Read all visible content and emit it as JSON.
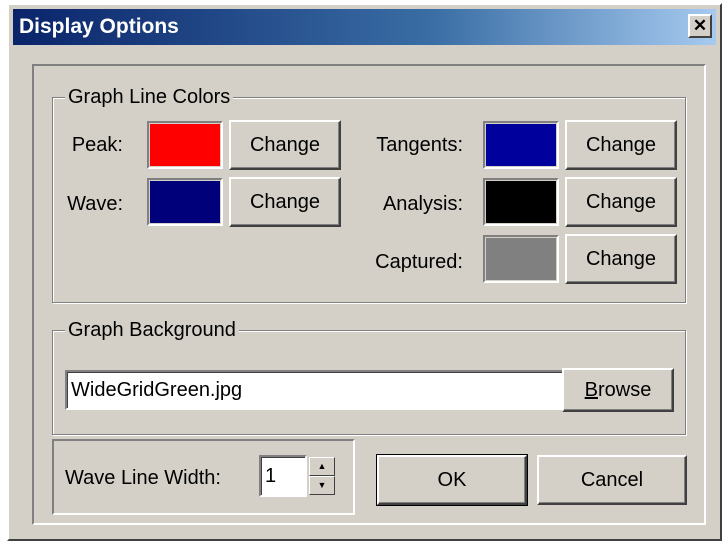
{
  "window": {
    "title": "Display Options",
    "close_glyph": "✕"
  },
  "graph_line_colors": {
    "legend": "Graph Line Colors",
    "items": [
      {
        "label": "Peak:",
        "color": "#ff0000",
        "button": "Change"
      },
      {
        "label": "Wave:",
        "color": "#00007b",
        "button": "Change"
      },
      {
        "label": "Tangents:",
        "color": "#00009c",
        "button": "Change"
      },
      {
        "label": "Analysis:",
        "color": "#000000",
        "button": "Change"
      },
      {
        "label": "Captured:",
        "color": "#808080",
        "button": "Change"
      }
    ]
  },
  "graph_background": {
    "legend": "Graph Background",
    "value": "WideGridGreen.jpg",
    "browse_label": "Browse",
    "browse_mnemonic": "B",
    "browse_rest": "rowse"
  },
  "wave_line_width": {
    "label": "Wave Line Width:",
    "value": "1",
    "up_glyph": "▲",
    "down_glyph": "▼"
  },
  "footer": {
    "ok_label": "OK",
    "cancel_label": "Cancel"
  },
  "colors": {
    "face": "#d4d0c8",
    "title_gradient_start": "#0a246a",
    "title_gradient_end": "#a6caf0"
  }
}
